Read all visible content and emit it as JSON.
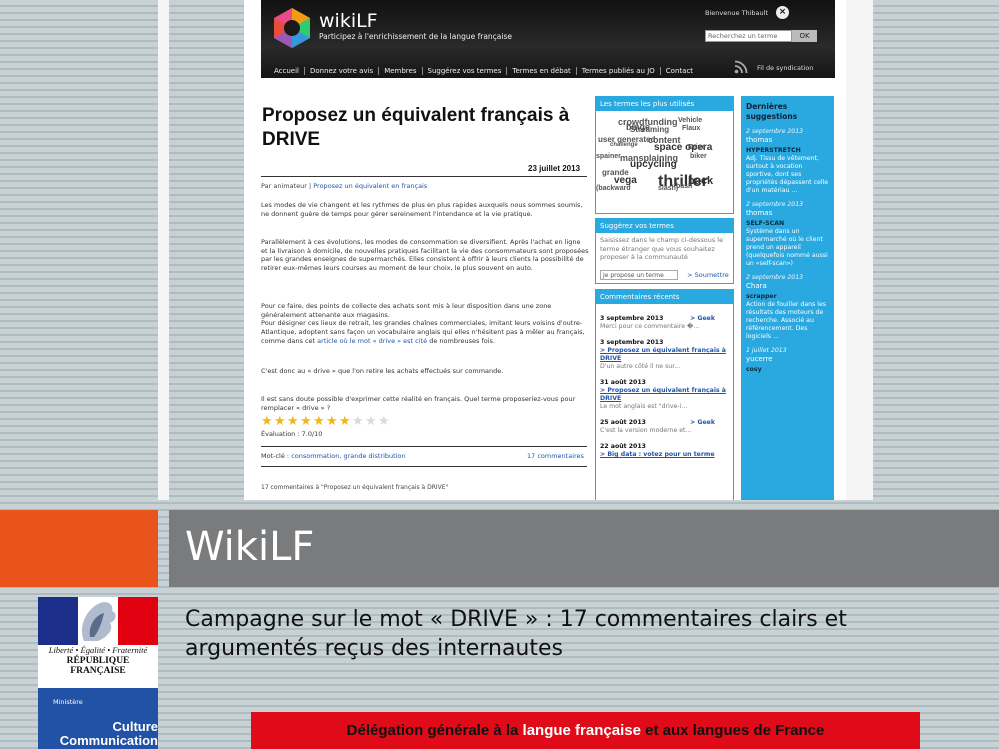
{
  "screenshot": {
    "header": {
      "brand": "wikiLF",
      "tagline": "Participez à l'enrichissement de la langue française",
      "welcome": "Bienvenue Thibault",
      "search_placeholder": "Recherchez un terme",
      "search_button": "OK",
      "syndication": "Fil de syndication",
      "nav": [
        "Accueil",
        "Donnez votre avis",
        "Membres",
        "Suggérez vos termes",
        "Termes en débat",
        "Termes publiés au JO",
        "Contact"
      ]
    },
    "article": {
      "title": "Proposez un équivalent français à DRIVE",
      "date": "23 juillet 2013",
      "byline_prefix": "Par animateur |",
      "byline_link": "Proposez un équivalent en français",
      "p1": "Les modes de vie changent et les rythmes de plus en plus rapides auxquels nous sommes soumis, ne donnent guère de temps pour gérer sereinement l'intendance et la vie pratique.",
      "p2": "Parallèlement à ces évolutions, les modes de consommation se diversifient. Après l'achat en ligne et la livraison à domicile, de nouvelles pratiques facilitant la vie des consommateurs sont proposées par les grandes enseignes de supermarchés. Elles consistent à offrir à leurs clients la possibilité de retirer eux-mêmes leurs courses au moment de leur choix, le plus souvent en auto.",
      "p3a": "Pour ce faire, des points de collecte des achats sont mis à leur disposition dans une zone généralement attenante aux magasins.",
      "p3b": "Pour désigner ces lieux de retrait, les grandes chaînes commerciales, imitant leurs voisins d'outre-Atlantique, adoptent sans façon un vocabulaire anglais qui elles n'hésitent pas à mêler au français, comme dans cet",
      "p3_link": "article où le mot « drive » est cité",
      "p3c": "de nombreuses fois.",
      "p4": "C'est donc au « drive » que l'on retire les achats effectués sur commande.",
      "p5": "Il est sans doute possible d'exprimer cette réalité en français. Quel terme proposeriez-vous pour remplacer « drive » ?",
      "rating": "Évaluation : 7.0/10",
      "rating_value": 7,
      "rating_max": 10,
      "tags_label": "Mot-clé :",
      "tags": "consommation, grande distribution",
      "comments_link": "17 commentaires",
      "comments_heading": "17 commentaires à \"Proposez un équivalent français à DRIVE\""
    },
    "sidebar": {
      "cloud_title": "Les termes les plus utilisés",
      "cloud_words": [
        "crowdfunding",
        "Vehicle",
        "binge",
        "Streaming",
        "Flaux",
        "user generated",
        "content",
        "space opera",
        "challenge",
        "Drive",
        "spainer",
        "mansplaining",
        "upcycling",
        "biker",
        "grande",
        "vega",
        "thriller",
        "back",
        "bash",
        "(backward",
        "slash)"
      ],
      "suggest_title": "Suggérez vos termes",
      "suggest_text": "Saisissez dans le champ ci-dessous le terme étranger que vous souhaitez proposer à la communauté",
      "suggest_placeholder": "Je propose un terme",
      "suggest_submit": "> Soumettre",
      "recent_title": "Commentaires récents",
      "recent": [
        {
          "date": "3 septembre 2013",
          "go": "> Geek",
          "text": "Merci pour ce commentaire �..."
        },
        {
          "date": "3 septembre 2013",
          "link": "> Proposez un équivalent français à DRIVE",
          "text": "D'un autre côté il ne sur..."
        },
        {
          "date": "31 août 2013",
          "link": "> Proposez un équivalent français à DRIVE",
          "text": "Le mot anglais est \"drive-i..."
        },
        {
          "date": "25 août 2013",
          "go": "> Geek",
          "text": "C'est la version moderne et..."
        },
        {
          "date": "22 août 2013",
          "link": "> Big data : votez pour un terme",
          "text": ""
        }
      ]
    },
    "latest": {
      "title": "Dernières suggestions",
      "items": [
        {
          "date": "2 septembre 2013",
          "user": "thomas",
          "term": "HYPERSTRETCH",
          "text": "Adj. Tissu de vêtement, surtout à vocation sportive, dont ses propriétés dépassent celle d'un matériau ..."
        },
        {
          "date": "2 septembre 2013",
          "user": "thomas",
          "term": "SELF-SCAN",
          "text": "Système dans un supermarché où le client prend un appareil (quelquefois nommé aussi un «self-scan»)"
        },
        {
          "date": "2 septembre 2013",
          "user": "Chara",
          "term": "scrapper",
          "text": "Action de fouiller dans les résultats des moteurs de recherche. Associé au référencement. Des logiciels ..."
        },
        {
          "date": "1 juillet 2013",
          "user": "yucerre",
          "term": "cosy",
          "text": ""
        }
      ]
    }
  },
  "slide": {
    "title": "WikiLF",
    "subtitle": "Campagne sur le mot « DRIVE » : 17 commentaires clairs et argumentés reçus des internautes",
    "rf_motto": "Liberté • Égalité • Fraternité",
    "rf_name": "RÉPUBLIQUE FRANÇAISE",
    "ministry_label": "Ministère",
    "ministry_culture": "Culture",
    "ministry_communication": "Communication",
    "dglf_part1": "Délégation générale à la ",
    "dglf_highlight": "langue française",
    "dglf_part2": " et aux langues de France"
  },
  "colors": {
    "orange": "#e8541c",
    "title_bar": "#7a7b7d",
    "wiki_blue": "#2aa8e0",
    "dglf_red": "#e10a18",
    "ministry_blue": "#2152a6"
  }
}
